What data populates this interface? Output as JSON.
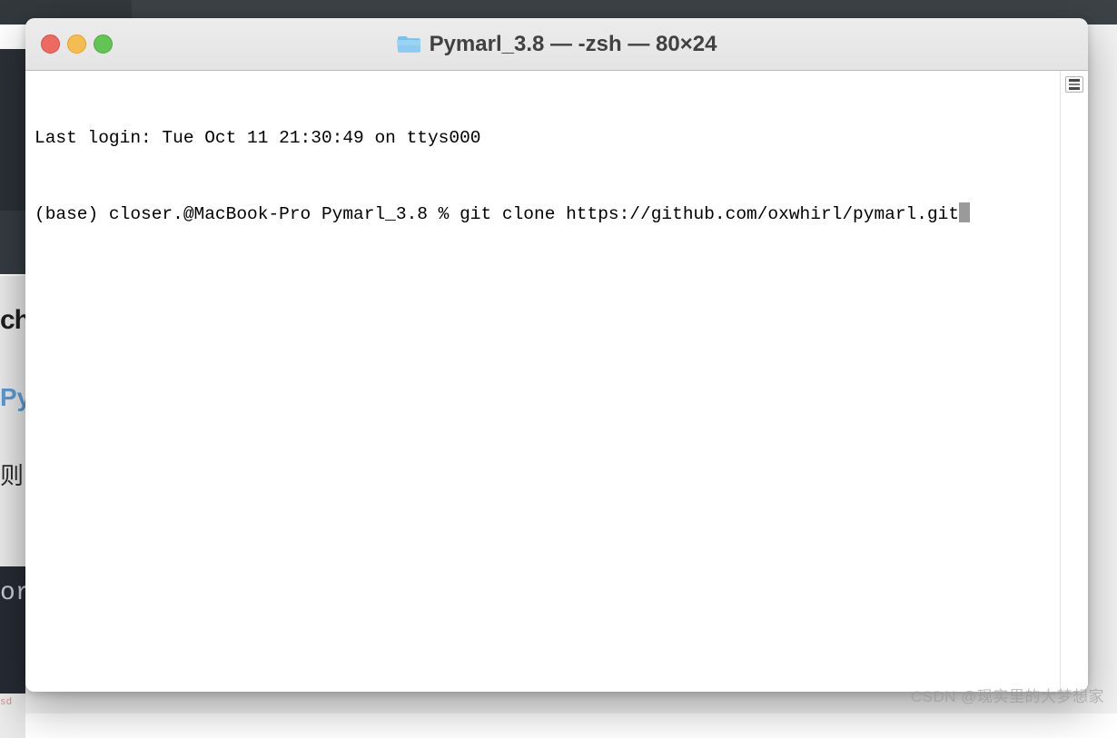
{
  "background": {
    "fragment_heading": "ch",
    "fragment_link": "Py",
    "fragment_chinese": "则",
    "fragment_code": "or",
    "fragment_small_red": "sd"
  },
  "window": {
    "title": "Pymarl_3.8 — -zsh — 80×24",
    "folder_icon": "folder-icon",
    "traffic_lights": [
      {
        "name": "close",
        "color": "#EC6A5F"
      },
      {
        "name": "minimize",
        "color": "#F5BD4F"
      },
      {
        "name": "maximize",
        "color": "#61C454"
      }
    ]
  },
  "terminal": {
    "lines": [
      "Last login: Tue Oct 11 21:30:49 on ttys000",
      "(base) closer.@MacBook-Pro Pymarl_3.8 % git clone https://github.com/oxwhirl/pymarl.git"
    ],
    "cursor": "block-cursor"
  },
  "scrollbar": {
    "marker_icon": "scroll-position-marker-icon"
  },
  "watermark": {
    "text": "CSDN @现实里的大梦想家"
  }
}
